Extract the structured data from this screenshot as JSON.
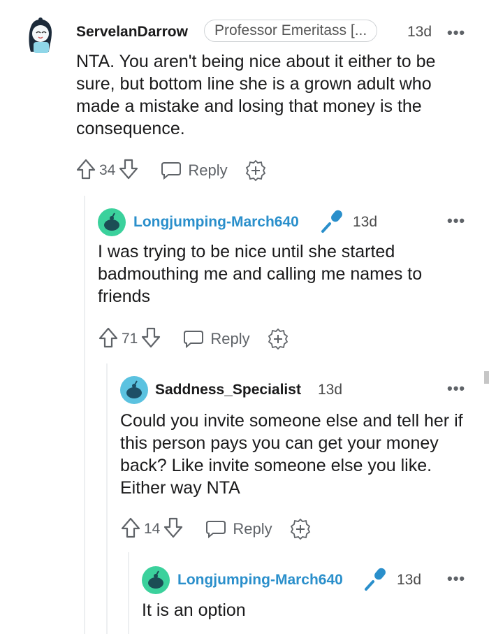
{
  "comments": [
    {
      "username": "ServelanDarrow",
      "flair": "Professor Emeritass [...",
      "time": "13d",
      "more": "•••",
      "body": "NTA. You aren't being nice about it either to be sure, but bottom line she is a grown adult who made a mistake and losing that money is the consequence.",
      "votes": "34",
      "reply_label": "Reply"
    },
    {
      "username": "Longjumping-March640",
      "time": "13d",
      "more": "•••",
      "body": "I was trying to be nice until she started badmouthing me and calling me names to friends",
      "votes": "71",
      "reply_label": "Reply"
    },
    {
      "username": "Saddness_Specialist",
      "time": "13d",
      "more": "•••",
      "body": "Could you invite someone else and tell her if this person pays you can get your money back? Like invite someone else you like. Either way NTA",
      "votes": "14",
      "reply_label": "Reply"
    },
    {
      "username": "Longjumping-March640",
      "time": "13d",
      "more": "•••",
      "body": "It is an option"
    }
  ],
  "colors": {
    "op_blue": "#2a8fcb",
    "mic_blue": "#2a8fcb",
    "thread_line": "#edeff1"
  },
  "icons": [
    "upvote-icon",
    "downvote-icon",
    "reply-bubble-icon",
    "award-plus-icon",
    "microphone-icon",
    "more-options-icon"
  ]
}
